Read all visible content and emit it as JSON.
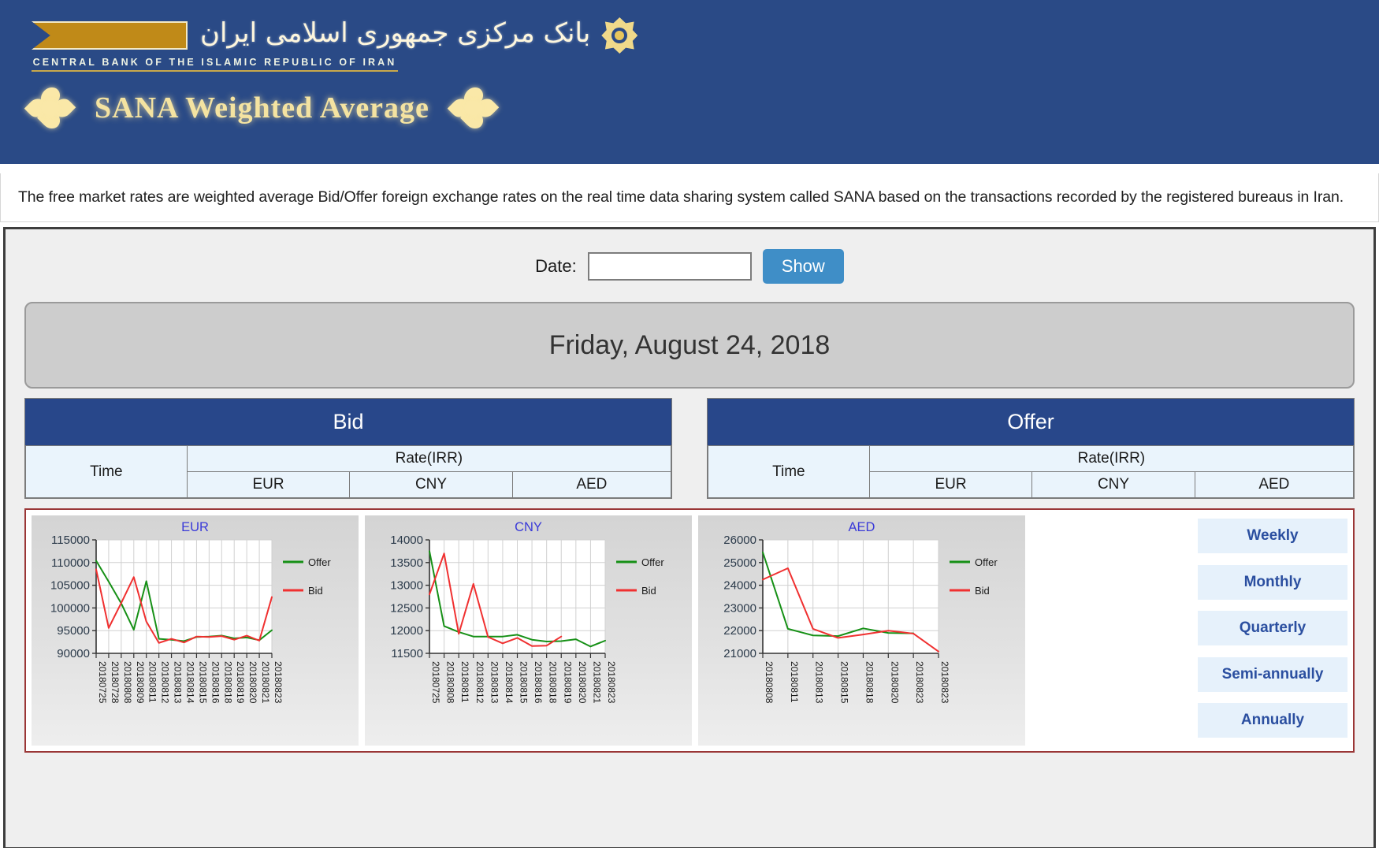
{
  "header": {
    "persian_title": "بانک مرکزی جمهوری اسلامی ایران",
    "caption": "CENTRAL BANK OF THE ISLAMIC REPUBLIC OF IRAN",
    "sana_title": "SANA Weighted  Average"
  },
  "description": "The free market rates are weighted average Bid/Offer foreign exchange rates on the real time data sharing system called SANA based on the transactions recorded by the registered bureaus in Iran.",
  "controls": {
    "date_label": "Date:",
    "date_value": "",
    "date_placeholder": "",
    "show_label": "Show"
  },
  "date_banner": "Friday, August 24, 2018",
  "tables": [
    {
      "title": "Bid",
      "time_header": "Time",
      "rate_header": "Rate(IRR)",
      "currencies": [
        "EUR",
        "CNY",
        "AED"
      ],
      "rows": []
    },
    {
      "title": "Offer",
      "time_header": "Time",
      "rate_header": "Rate(IRR)",
      "currencies": [
        "EUR",
        "CNY",
        "AED"
      ],
      "rows": []
    }
  ],
  "period_buttons": [
    "Weekly",
    "Monthly",
    "Quarterly",
    "Semi-annually",
    "Annually"
  ],
  "colors": {
    "header_blue": "#2a4a86",
    "table_header_blue": "#28478a",
    "offer_green": "#169016",
    "bid_red": "#f03030",
    "accent_button": "#3f8ec7",
    "chart_border_red": "#9a3636",
    "period_button_bg": "#e6f1fb",
    "period_button_text": "#2b4fa0"
  },
  "chart_data": [
    {
      "type": "line",
      "title": "EUR",
      "xlabel": "",
      "ylabel": "",
      "ylim": [
        90000,
        115000
      ],
      "yticks": [
        90000,
        95000,
        100000,
        105000,
        110000,
        115000
      ],
      "grid": true,
      "legend_position": "right",
      "categories": [
        "20180725",
        "20180728",
        "20180808",
        "20180809",
        "20180811",
        "20180812",
        "20180813",
        "20180814",
        "20180815",
        "20180816",
        "20180818",
        "20180819",
        "20180820",
        "20180821",
        "20180823"
      ],
      "series": [
        {
          "name": "Offer",
          "color": "#169016",
          "values": [
            110400,
            105800,
            101000,
            95200,
            105900,
            93200,
            93000,
            92700,
            93600,
            93700,
            93900,
            93300,
            93500,
            92900,
            95100
          ]
        },
        {
          "name": "Bid",
          "color": "#f03030",
          "values": [
            108500,
            95600,
            101100,
            106800,
            97000,
            92300,
            93200,
            92400,
            93700,
            93600,
            93800,
            93000,
            93900,
            92800,
            102400
          ]
        }
      ]
    },
    {
      "type": "line",
      "title": "CNY",
      "xlabel": "",
      "ylabel": "",
      "ylim": [
        11500,
        14000
      ],
      "yticks": [
        11500,
        12000,
        12500,
        13000,
        13500,
        14000
      ],
      "grid": true,
      "legend_position": "right",
      "categories": [
        "20180725",
        "20180808",
        "20180811",
        "20180812",
        "20180813",
        "20180814",
        "20180815",
        "20180816",
        "20180818",
        "20180819",
        "20180820",
        "20180821",
        "20180823"
      ],
      "series": [
        {
          "name": "Offer",
          "color": "#169016",
          "values": [
            13750,
            12100,
            11970,
            11870,
            11870,
            11870,
            11910,
            11800,
            11760,
            11770,
            11810,
            11650,
            11780
          ]
        },
        {
          "name": "Bid",
          "color": "#f03030",
          "values": [
            12800,
            13700,
            11930,
            13030,
            11860,
            11720,
            11840,
            11660,
            11670,
            11870,
            null,
            null,
            null
          ]
        }
      ]
    },
    {
      "type": "line",
      "title": "AED",
      "xlabel": "",
      "ylabel": "",
      "ylim": [
        21000,
        26000
      ],
      "yticks": [
        21000,
        22000,
        23000,
        24000,
        25000,
        26000
      ],
      "grid": true,
      "legend_position": "right",
      "categories": [
        "20180808",
        "20180811",
        "20180813",
        "20180815",
        "20180818",
        "20180820",
        "20180823",
        "20180823"
      ],
      "series": [
        {
          "name": "Offer",
          "color": "#169016",
          "values": [
            25450,
            22080,
            21790,
            21760,
            22100,
            21900,
            21880,
            null
          ]
        },
        {
          "name": "Bid",
          "color": "#f03030",
          "values": [
            24250,
            24750,
            22080,
            21680,
            21830,
            22000,
            21870,
            21080
          ]
        }
      ]
    }
  ],
  "legend": {
    "offer": "Offer",
    "bid": "Bid"
  }
}
